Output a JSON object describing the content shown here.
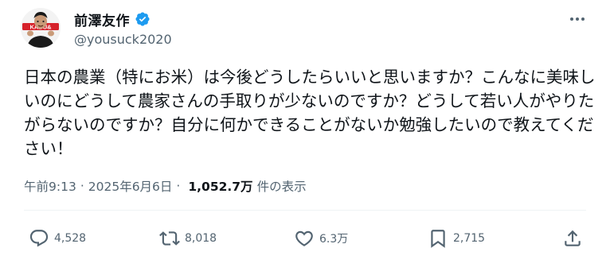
{
  "author": {
    "display_name": "前澤友作",
    "handle": "@yousuck2020",
    "verified": true,
    "avatar_badge_text": "KABU&"
  },
  "post": {
    "text": "日本の農業（特にお米）は今後どうしたらいいと思いますか？こんなに美味しいのにどうして農家さんの手取りが少ないのですか？どうして若い人がやりたがらないのですか？自分に何かできることがないか勉強したいので教えてください！",
    "time": "午前9:13",
    "dot1": "·",
    "date": "2025年6月6日",
    "dot2": "·",
    "views_count": "1,052.7万",
    "views_label": "件の表示"
  },
  "actions": {
    "replies": "4,528",
    "reposts": "8,018",
    "likes": "6.3万",
    "bookmarks": "2,715"
  },
  "colors": {
    "text": "#0f1419",
    "secondary": "#536471",
    "verified_blue": "#1d9bf0",
    "avatar_banner_red": "#d6212a"
  },
  "icons": [
    "verified-badge-icon",
    "more-icon",
    "reply-icon",
    "repost-icon",
    "like-icon",
    "bookmark-icon",
    "share-icon"
  ]
}
